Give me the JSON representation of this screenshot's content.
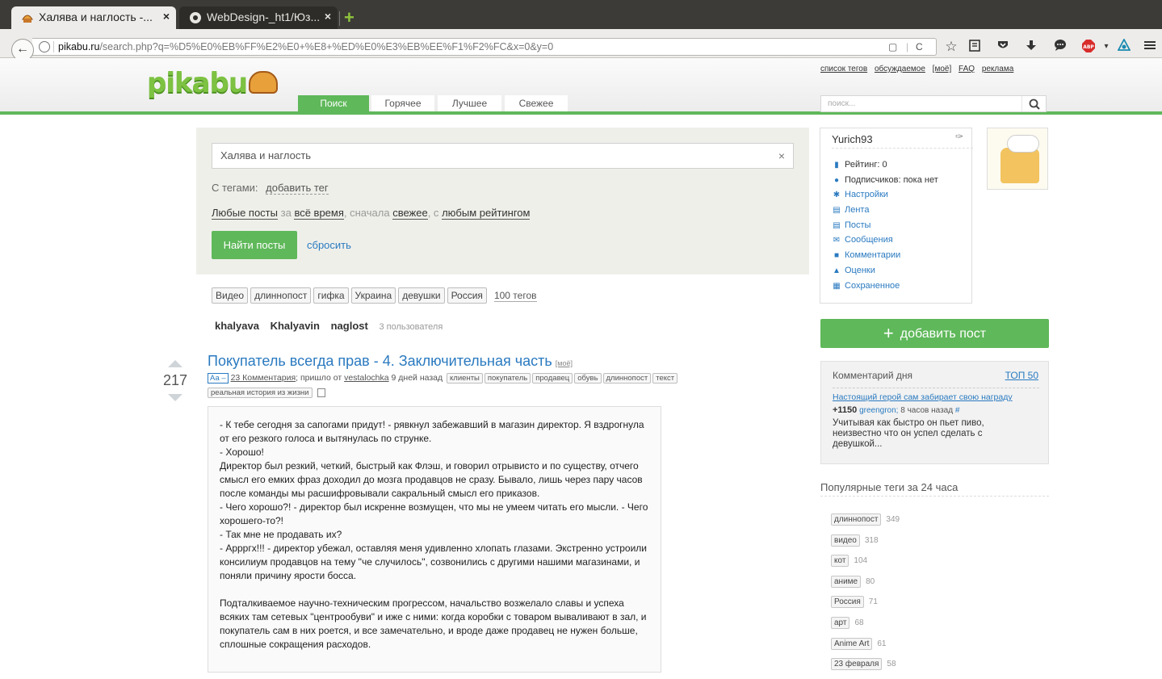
{
  "browser": {
    "tabs": [
      {
        "title": "Халява и наглость -...",
        "close": "×"
      },
      {
        "title": "WebDesign-_ht1/Юз...",
        "close": "×"
      }
    ],
    "new_tab": "+",
    "url_domain": "pikabu.ru",
    "url_path": "/search.php?q=%D5%E0%EB%FF%E2%E0+%E8+%ED%E0%E3%EB%EE%F1%F2%FC&x=0&y=0",
    "back_glyph": "←",
    "reload_glyph": "C",
    "toolbar_icons": [
      "star-icon",
      "bookmarks-icon",
      "pocket-icon",
      "download-icon",
      "chat-icon",
      "adblock-icon",
      "sync-icon",
      "menu-icon"
    ]
  },
  "site": {
    "logo": "pikabu",
    "nav_tabs": [
      "Поиск",
      "Горячее",
      "Лучшее",
      "Свежее"
    ],
    "top_links": [
      "список тегов",
      "обсуждаемое",
      "[моё]",
      "FAQ",
      "реклама"
    ],
    "search_placeholder": "поиск...",
    "accent": "#5fb85a",
    "link_color": "#2a7ac0"
  },
  "search": {
    "query": "Халява и наглость",
    "clear": "×",
    "tags_label": "С тегами:",
    "add_tag": "добавить тег",
    "filter": {
      "any_posts": "Любые посты",
      "for": "за",
      "period": "всё время",
      "sort_prefix": ", сначала",
      "sort": "свежее",
      "rating_prefix": ", с",
      "rating": "любым рейтингом"
    },
    "find_button": "Найти посты",
    "reset": "сбросить",
    "tag_chips": [
      "Видео",
      "длиннопост",
      "гифка",
      "Украина",
      "девушки",
      "Россия"
    ],
    "tags_count": "100 тегов",
    "users": [
      "khalyava",
      "Khalyavin",
      "naglost"
    ],
    "users_count": "3 пользователя"
  },
  "post": {
    "rating": "217",
    "title": "Покупатель всегда прав - 4. Заключительная часть",
    "mine": "[моё]",
    "aa": "Аа –",
    "comments": "23 Комментария",
    "from": "; пришло от",
    "author": "vestalochka",
    "when": "9 дней назад",
    "tags": [
      "клиенты",
      "покупатель",
      "продавец",
      "обувь",
      "длиннопост",
      "текст"
    ],
    "tags_row2": [
      "реальная история из жизни"
    ],
    "paragraphs": [
      "- К тебе сегодня за сапогами придут! - рявкнул забежавший в магазин директор. Я вздрогнула от его резкого голоса и вытянулась по струнке.\n- Хорошо!\nДиректор был резкий, четкий, быстрый как Флэш, и говорил отрывисто и по существу, отчего смысл его емких фраз доходил до мозга продавцов не сразу. Бывало, лишь через пару часов после команды мы расшифровывали сакральный смысл его приказов.\n- Чего хорошо?! - директор был искренне возмущен, что мы не умеем читать его мысли. - Чего хорошего-то?!\n- Так мне не продавать их?\n- Аррргх!!! - директор убежал, оставляя меня удивленно хлопать глазами. Экстренно устроили консилиум продавцов на тему \"че случилось\", созвонились с другими нашими магазинами, и поняли причину ярости босса.",
      "Подталкиваемое научно-техническим прогрессом, начальство возжелало славы и успеха всяких там сетевых \"центрообуви\" и иже с ними: когда коробки с товаром вываливают в зал, и покупатель сам в них роется, и все замечательно, и вроде даже продавец не нужен больше, сплошные сокращения расходов."
    ]
  },
  "sidebar": {
    "username": "Yurich93",
    "menu": [
      {
        "icon": "rating-icon",
        "glyph": "▮",
        "label": "Рейтинг: 0"
      },
      {
        "icon": "subscribers-icon",
        "glyph": "●",
        "label": "Подписчиков: пока нет"
      },
      {
        "icon": "settings-icon",
        "glyph": "✱",
        "label": "Настройки"
      },
      {
        "icon": "feed-icon",
        "glyph": "▤",
        "label": "Лента"
      },
      {
        "icon": "posts-icon",
        "glyph": "▤",
        "label": "Посты"
      },
      {
        "icon": "messages-icon",
        "glyph": "✉",
        "label": "Сообщения"
      },
      {
        "icon": "comments-icon",
        "glyph": "■",
        "label": "Комментарии"
      },
      {
        "icon": "ratings-icon",
        "glyph": "▲",
        "label": "Оценки"
      },
      {
        "icon": "saved-icon",
        "glyph": "▦",
        "label": "Сохраненное"
      }
    ],
    "add_post": "добавить пост",
    "comment_of_day": {
      "heading": "Комментарий дня",
      "top": "ТОП 50",
      "title": "Настоящий герой сам забирает свою награду",
      "score": "+1150",
      "user": "greengron;",
      "when": "8 часов назад",
      "hash": "#",
      "text": "Учитывая как быстро он пьет пиво, неизвестно что он успел сделать с девушкой..."
    },
    "popular_title": "Популярные теги за 24 часа",
    "popular_tags": [
      {
        "tag": "длиннопост",
        "count": "349"
      },
      {
        "tag": "видео",
        "count": "318"
      },
      {
        "tag": "кот",
        "count": "104"
      },
      {
        "tag": "аниме",
        "count": "80"
      },
      {
        "tag": "Россия",
        "count": "71"
      },
      {
        "tag": "арт",
        "count": "68"
      },
      {
        "tag": "Anime Art",
        "count": "61"
      },
      {
        "tag": "23 февраля",
        "count": "58"
      }
    ]
  }
}
